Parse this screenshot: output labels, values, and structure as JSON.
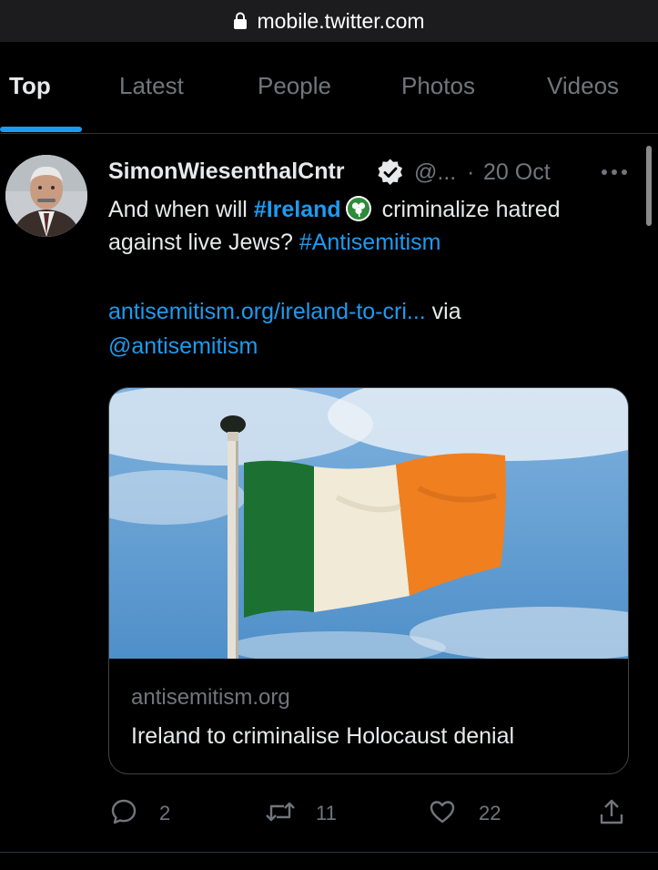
{
  "browser": {
    "url": "mobile.twitter.com"
  },
  "tabs": [
    {
      "label": "Top",
      "active": true
    },
    {
      "label": "Latest",
      "active": false
    },
    {
      "label": "People",
      "active": false
    },
    {
      "label": "Photos",
      "active": false
    },
    {
      "label": "Videos",
      "active": false
    }
  ],
  "tweet": {
    "author_name": "SimonWiesenthalCntr",
    "verified": true,
    "handle": "@...",
    "separator": "·",
    "time": "20 Oct",
    "text_line1_a": "And when will ",
    "hashtag_ireland": "#Ireland",
    "text_line1_b": " criminalize hatred",
    "text_line2_a": "against live Jews? ",
    "hashtag_antisemitism": "#Antisemitism",
    "link_text": "antisemitism.org/ireland-to-cri...",
    "via_text": " via",
    "mention": "@antisemitism",
    "card": {
      "domain": "antisemitism.org",
      "title": "Ireland to criminalise Holocaust denial"
    },
    "actions": {
      "replies": "2",
      "retweets": "11",
      "likes": "22"
    }
  },
  "colors": {
    "background": "#000000",
    "accent": "#1d9bf0",
    "muted": "#71767b",
    "text": "#e7e9ea"
  },
  "icons": [
    "lock-icon",
    "verified-icon",
    "more-icon",
    "shamrock-emoji-icon",
    "reply-icon",
    "retweet-icon",
    "like-icon",
    "share-icon"
  ]
}
